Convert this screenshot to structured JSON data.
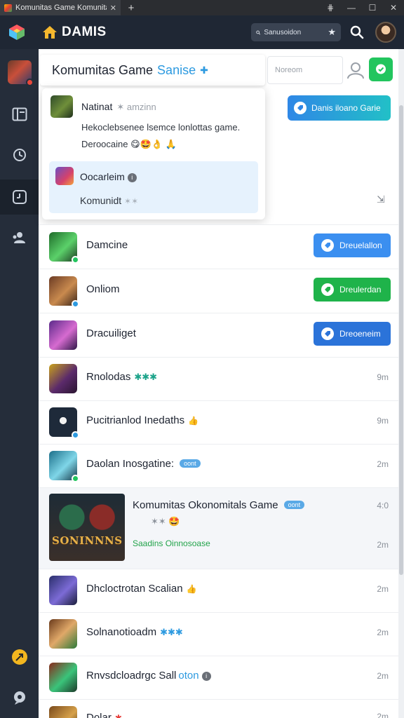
{
  "window": {
    "tab_title": "Komunitas Game Komunitas Game",
    "tab_close": "✕",
    "new_tab": "+",
    "controls": [
      "⋕",
      "—",
      "☐",
      "✕"
    ]
  },
  "appbar": {
    "brand": "DAMIS",
    "search_placeholder": "Sanusoidon"
  },
  "header": {
    "title": "Komumitas Game",
    "title_accent": "Sanise",
    "mini_search_placeholder": "Noreom"
  },
  "top_action": {
    "label": "Danis iloano Garie",
    "gradient": [
      "#2f87e6",
      "#22c0c7"
    ]
  },
  "popup": {
    "name": "Natinat",
    "subtitle": "✶ amzinn",
    "line1": "Hekoclebsenee lsemce lonlottas game.",
    "line2": "Deroocaine 😋🤩👌 🙏",
    "panel_title": "Oocarleim",
    "panel_sub": "Komunidt",
    "panel_stars": "✶✶"
  },
  "list": [
    {
      "title": "Damcine",
      "action": "Dreuelallon",
      "action_color": "#3b8ff0"
    },
    {
      "title": "Onliom",
      "action": "Dreulerdan",
      "action_color": "#1fb34a"
    },
    {
      "title": "Dracuiliget",
      "action": "Dreoeneim",
      "action_color": "#2b73d9"
    },
    {
      "title": "Rnolodas",
      "stars": "✱✱✱",
      "time": "9m"
    },
    {
      "title": "Pucitrianlod Inedaths",
      "emoji": "👍",
      "time": "9m"
    },
    {
      "title": "Daolan Inosgatine:",
      "tag": "oont",
      "time": "2m"
    },
    {
      "title": "Dhcloctrotan Scalian",
      "emoji": "👍",
      "time": "2m"
    },
    {
      "title": "Solnanotioadm",
      "stars": "✱✱✱",
      "time": "2m"
    },
    {
      "title": "Rnvsdcloadrgc Sall",
      "suffix": "oton",
      "time": "2m"
    },
    {
      "title": "Dolar",
      "emoji": "✱",
      "time": "2m"
    }
  ],
  "featured": {
    "title": "Komumitas Okonomitals Game",
    "tag": "oont",
    "stars": "✶✶ 🤩",
    "subtitle": "Saadins Oinnosoase",
    "image_text": "SONINNNS",
    "time1": "4:0",
    "time2": "2m"
  }
}
